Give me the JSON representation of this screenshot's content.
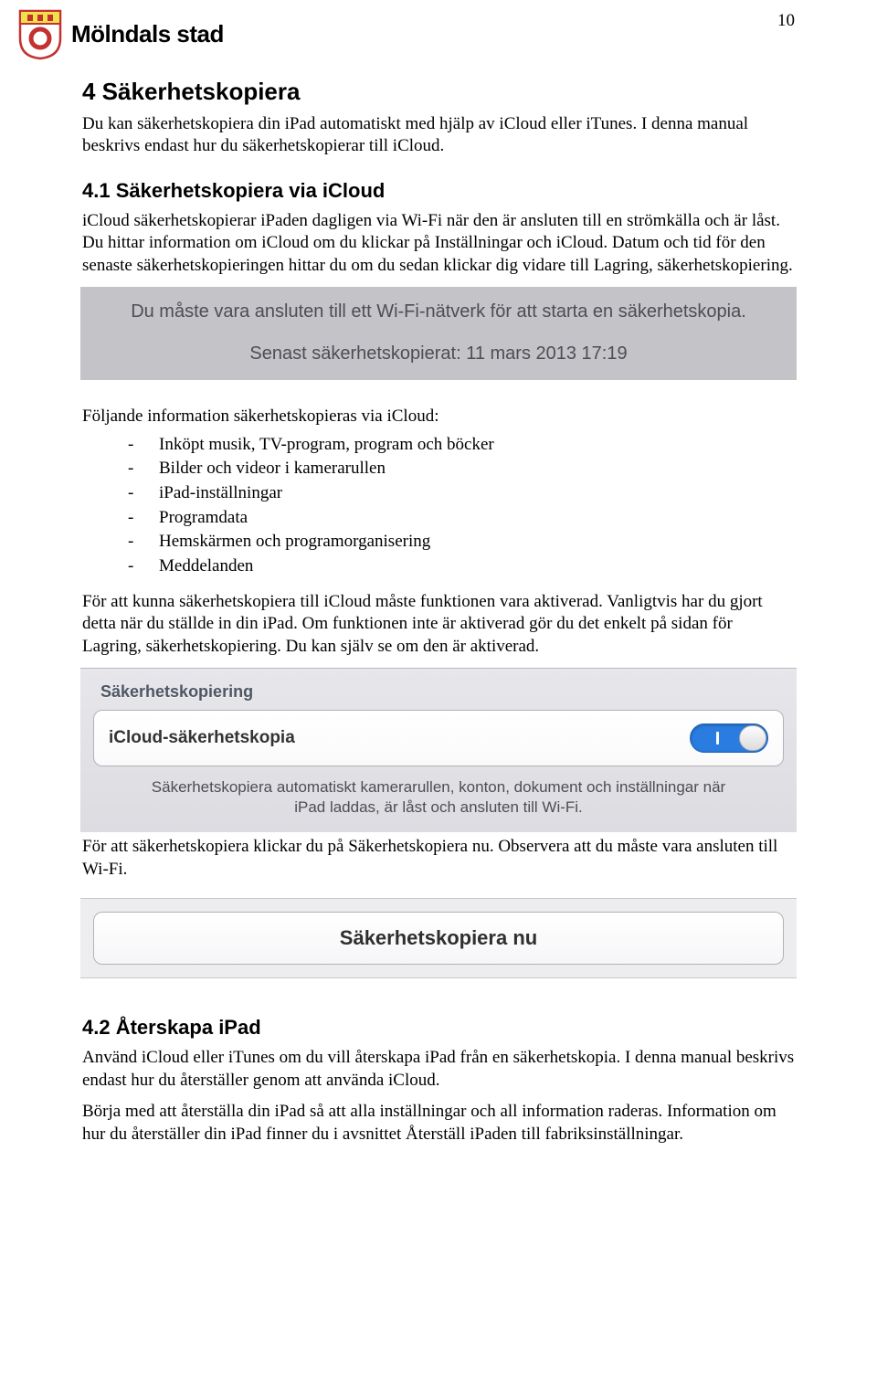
{
  "header": {
    "org": "Mölndals stad",
    "page_number": "10"
  },
  "section4": {
    "heading": "4  Säkerhetskopiera",
    "intro": "Du kan säkerhetskopiera din iPad automatiskt med hjälp av iCloud eller iTunes. I denna manual beskrivs endast hur du säkerhetskopierar till iCloud."
  },
  "section41": {
    "heading": "4.1  Säkerhetskopiera via iCloud",
    "body": "iCloud säkerhetskopierar iPaden dagligen via Wi-Fi när den är ansluten till en strömkälla och är låst. Du hittar information om iCloud om du klickar på Inställningar och iCloud. Datum och tid för den senaste säkerhetskopieringen hittar du om du sedan klickar dig vidare till Lagring, säkerhetskopiering."
  },
  "ios_notice": {
    "line1": "Du måste vara ansluten till ett Wi-Fi-nätverk för att starta en säkerhetskopia.",
    "line2": "Senast säkerhetskopierat: 11 mars 2013 17:19"
  },
  "list": {
    "intro": "Följande information säkerhetskopieras via iCloud:",
    "items": [
      "Inköpt musik, TV-program, program och böcker",
      "Bilder och videor i kamerarullen",
      "iPad-inställningar",
      "Programdata",
      "Hemskärmen och programorganisering",
      "Meddelanden"
    ]
  },
  "para_after_list": "För att kunna säkerhetskopiera till iCloud måste funktionen vara aktiverad. Vanligtvis har du gjort detta när du ställde in din iPad. Om funktionen inte är aktiverad gör du det enkelt på sidan för Lagring, säkerhetskopiering. Du kan själv se om den är aktiverad.",
  "settings": {
    "section_label": "Säkerhetskopiering",
    "row_label": "iCloud-säkerhetskopia",
    "toggle_on": true,
    "desc": "Säkerhetskopiera automatiskt kamerarullen, konton, dokument och inställningar när iPad laddas, är låst och ansluten till Wi-Fi."
  },
  "para_after_settings": "För att säkerhetskopiera klickar du på Säkerhetskopiera nu. Observera att du måste vara ansluten till Wi-Fi.",
  "backup_button": "Säkerhetskopiera nu",
  "section42": {
    "heading": "4.2  Återskapa iPad",
    "p1": "Använd iCloud eller iTunes om du vill återskapa iPad från en säkerhetskopia. I denna manual beskrivs endast hur du återställer genom att använda iCloud.",
    "p2": "Börja med att återställa din iPad så att alla inställningar och all information raderas. Information om hur du återställer din iPad finner du i avsnittet Återställ iPaden till fabriksinställningar."
  }
}
